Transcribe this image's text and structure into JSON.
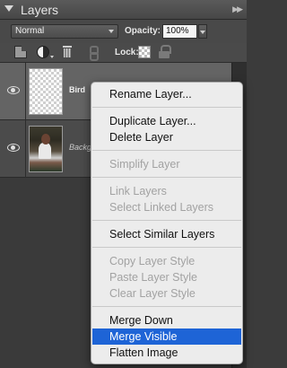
{
  "header": {
    "title": "Layers",
    "panel_menu_icon": "double-chevron-right"
  },
  "options": {
    "blend_mode": "Normal",
    "opacity_label": "Opacity:",
    "opacity_value": "100%",
    "lock_label": "Lock:"
  },
  "layers": [
    {
      "name": "Bird",
      "visible": true,
      "selected": true,
      "thumbnail": "transparent"
    },
    {
      "name": "Background",
      "visible": true,
      "selected": false,
      "thumbnail": "photo"
    }
  ],
  "context_menu": {
    "items": [
      {
        "label": "Rename Layer...",
        "enabled": true
      },
      {
        "label": "Duplicate Layer...",
        "enabled": true
      },
      {
        "label": "Delete Layer",
        "enabled": true
      },
      {
        "label": "Simplify Layer",
        "enabled": false
      },
      {
        "label": "Link Layers",
        "enabled": false
      },
      {
        "label": "Select Linked Layers",
        "enabled": false
      },
      {
        "label": "Select Similar Layers",
        "enabled": true
      },
      {
        "label": "Copy Layer Style",
        "enabled": false
      },
      {
        "label": "Paste Layer Style",
        "enabled": false
      },
      {
        "label": "Clear Layer Style",
        "enabled": false
      },
      {
        "label": "Merge Down",
        "enabled": true
      },
      {
        "label": "Merge Visible",
        "enabled": true,
        "highlighted": true
      },
      {
        "label": "Flatten Image",
        "enabled": true
      }
    ]
  },
  "colors": {
    "panel_bg": "#3b3b3b",
    "highlight": "#1e64d6",
    "menu_bg": "#ececec",
    "selected_row": "#646464"
  }
}
